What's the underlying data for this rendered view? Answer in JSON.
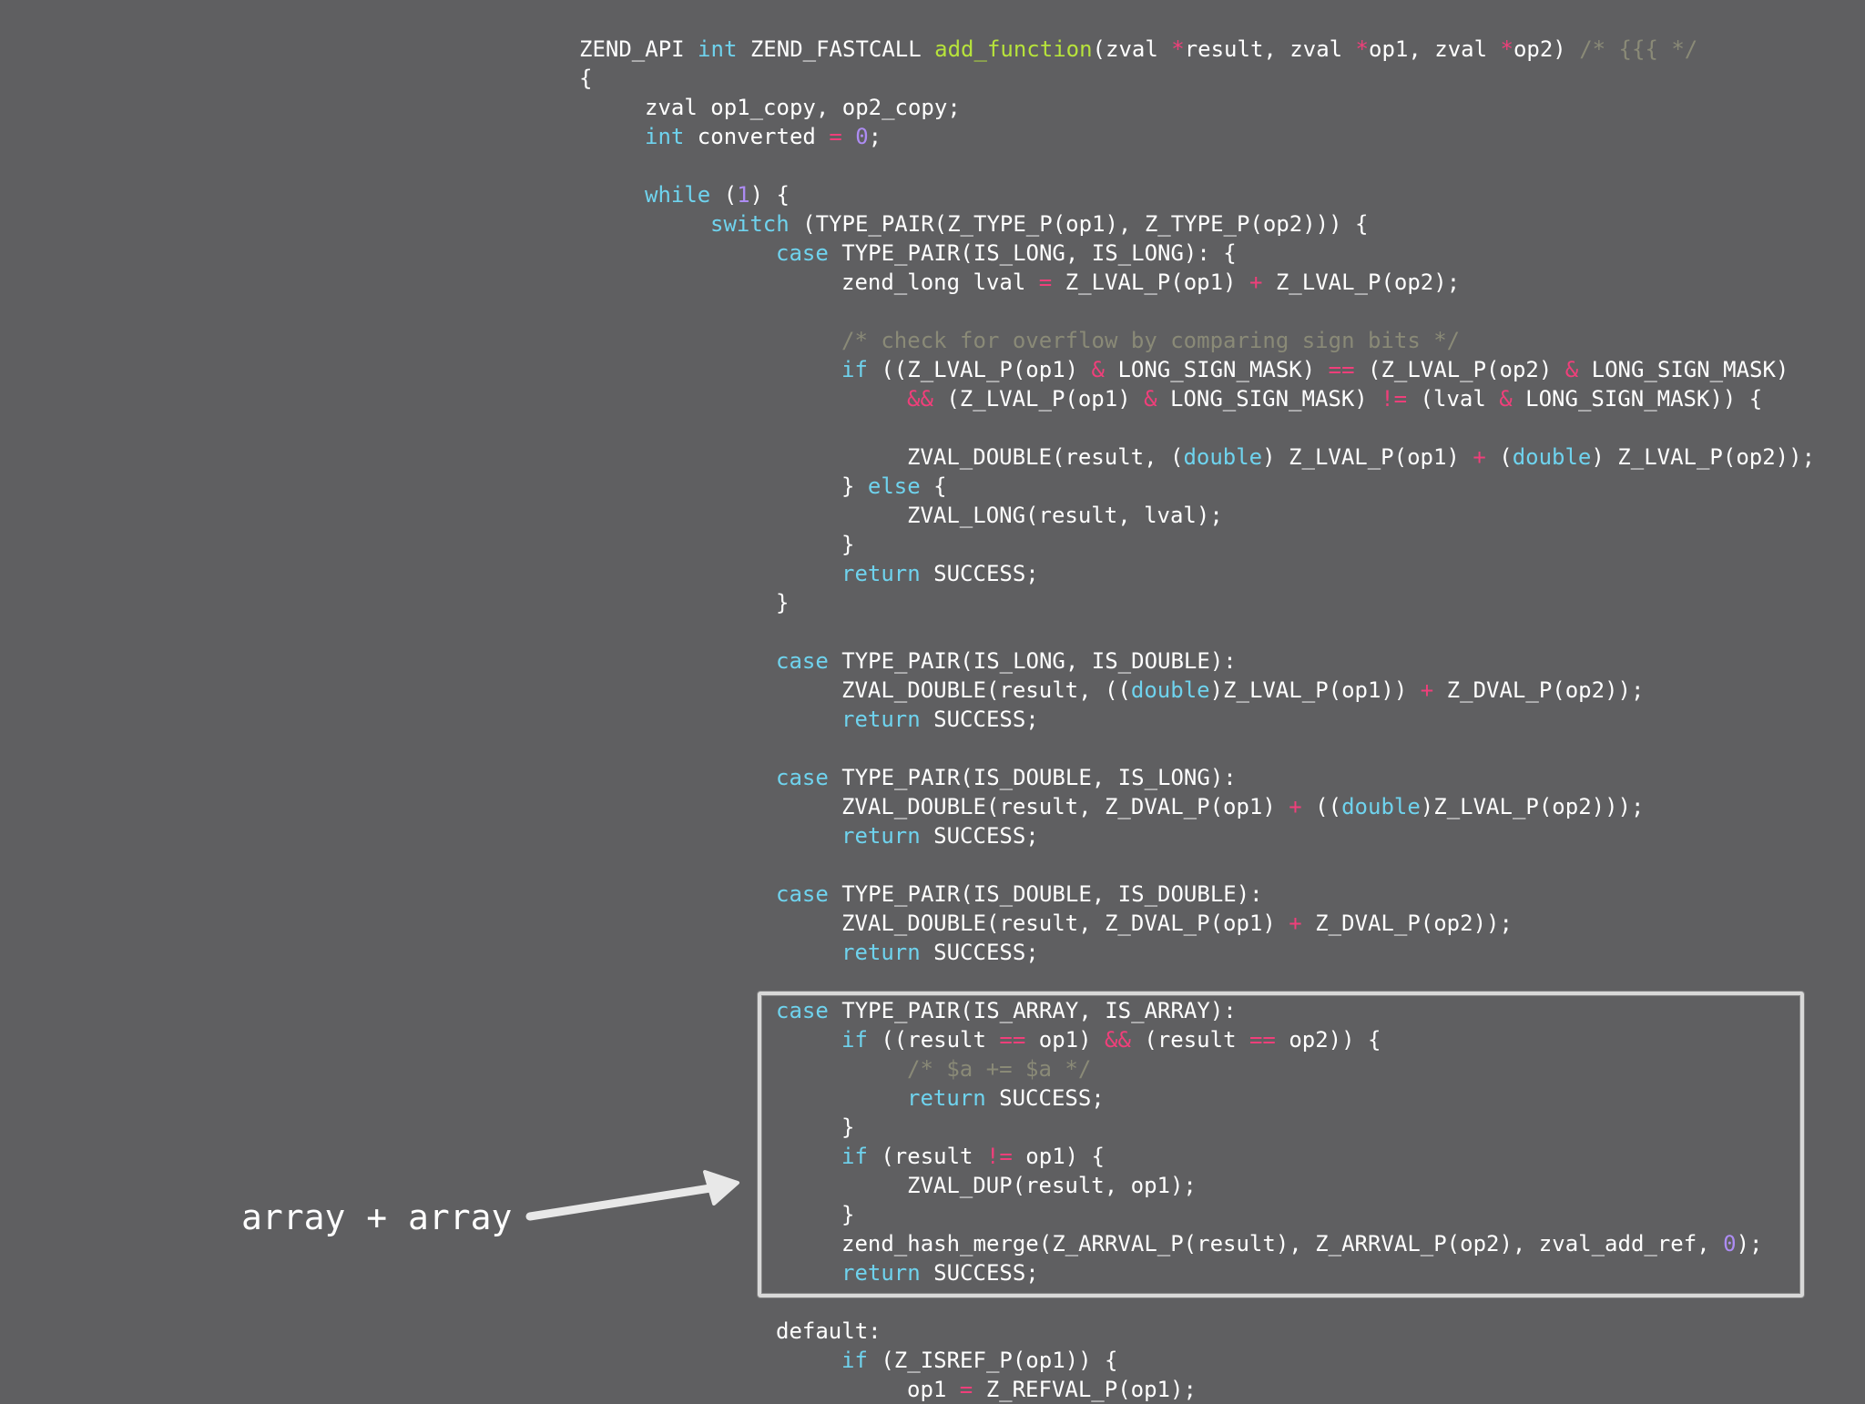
{
  "colors": {
    "background": "#5f5f61",
    "plain": "#ffffff",
    "keyword": "#6fd3ee",
    "function": "#b7e33b",
    "operator": "#ef3f7a",
    "number": "#ad8cf3",
    "comment": "#8a8a77",
    "highlight_border": "#d8d8d8"
  },
  "annotation": {
    "label": "array + array"
  },
  "code_lines": [
    {
      "indent": 0,
      "tokens": [
        [
          "tx",
          "ZEND_API "
        ],
        [
          "kw",
          "int"
        ],
        [
          "tx",
          " ZEND_FASTCALL "
        ],
        [
          "fn",
          "add_function"
        ],
        [
          "tx",
          "(zval "
        ],
        [
          "op",
          "*"
        ],
        [
          "tx",
          "result, zval "
        ],
        [
          "op",
          "*"
        ],
        [
          "tx",
          "op1, zval "
        ],
        [
          "op",
          "*"
        ],
        [
          "tx",
          "op2) "
        ],
        [
          "cm",
          "/* {{{ */"
        ]
      ]
    },
    {
      "indent": 0,
      "tokens": [
        [
          "tx",
          "{"
        ]
      ]
    },
    {
      "indent": 1,
      "tokens": [
        [
          "tx",
          "zval op1_copy, op2_copy;"
        ]
      ]
    },
    {
      "indent": 1,
      "tokens": [
        [
          "kw",
          "int"
        ],
        [
          "tx",
          " converted "
        ],
        [
          "op",
          "="
        ],
        [
          "tx",
          " "
        ],
        [
          "num",
          "0"
        ],
        [
          "tx",
          ";"
        ]
      ]
    },
    {
      "indent": 0,
      "tokens": []
    },
    {
      "indent": 1,
      "tokens": [
        [
          "kw",
          "while"
        ],
        [
          "tx",
          " ("
        ],
        [
          "num",
          "1"
        ],
        [
          "tx",
          ") {"
        ]
      ]
    },
    {
      "indent": 2,
      "tokens": [
        [
          "kw",
          "switch"
        ],
        [
          "tx",
          " (TYPE_PAIR(Z_TYPE_P(op1), Z_TYPE_P(op2))) {"
        ]
      ]
    },
    {
      "indent": 3,
      "tokens": [
        [
          "kw",
          "case"
        ],
        [
          "tx",
          " TYPE_PAIR(IS_LONG, IS_LONG): {"
        ]
      ]
    },
    {
      "indent": 4,
      "tokens": [
        [
          "tx",
          "zend_long lval "
        ],
        [
          "op",
          "="
        ],
        [
          "tx",
          " Z_LVAL_P(op1) "
        ],
        [
          "op",
          "+"
        ],
        [
          "tx",
          " Z_LVAL_P(op2);"
        ]
      ]
    },
    {
      "indent": 0,
      "tokens": []
    },
    {
      "indent": 4,
      "tokens": [
        [
          "cm",
          "/* check for overflow by comparing sign bits */"
        ]
      ]
    },
    {
      "indent": 4,
      "tokens": [
        [
          "kw",
          "if"
        ],
        [
          "tx",
          " ((Z_LVAL_P(op1) "
        ],
        [
          "op",
          "&"
        ],
        [
          "tx",
          " LONG_SIGN_MASK) "
        ],
        [
          "op",
          "=="
        ],
        [
          "tx",
          " (Z_LVAL_P(op2) "
        ],
        [
          "op",
          "&"
        ],
        [
          "tx",
          " LONG_SIGN_MASK)"
        ]
      ]
    },
    {
      "indent": 5,
      "tokens": [
        [
          "op",
          "&&"
        ],
        [
          "tx",
          " (Z_LVAL_P(op1) "
        ],
        [
          "op",
          "&"
        ],
        [
          "tx",
          " LONG_SIGN_MASK) "
        ],
        [
          "op",
          "!="
        ],
        [
          "tx",
          " (lval "
        ],
        [
          "op",
          "&"
        ],
        [
          "tx",
          " LONG_SIGN_MASK)) {"
        ]
      ]
    },
    {
      "indent": 0,
      "tokens": []
    },
    {
      "indent": 5,
      "tokens": [
        [
          "tx",
          "ZVAL_DOUBLE(result, ("
        ],
        [
          "kw",
          "double"
        ],
        [
          "tx",
          ") Z_LVAL_P(op1) "
        ],
        [
          "op",
          "+"
        ],
        [
          "tx",
          " ("
        ],
        [
          "kw",
          "double"
        ],
        [
          "tx",
          ") Z_LVAL_P(op2));"
        ]
      ]
    },
    {
      "indent": 4,
      "tokens": [
        [
          "tx",
          "} "
        ],
        [
          "kw",
          "else"
        ],
        [
          "tx",
          " {"
        ]
      ]
    },
    {
      "indent": 5,
      "tokens": [
        [
          "tx",
          "ZVAL_LONG(result, lval);"
        ]
      ]
    },
    {
      "indent": 4,
      "tokens": [
        [
          "tx",
          "}"
        ]
      ]
    },
    {
      "indent": 4,
      "tokens": [
        [
          "kw",
          "return"
        ],
        [
          "tx",
          " SUCCESS;"
        ]
      ]
    },
    {
      "indent": 3,
      "tokens": [
        [
          "tx",
          "}"
        ]
      ]
    },
    {
      "indent": 0,
      "tokens": []
    },
    {
      "indent": 3,
      "tokens": [
        [
          "kw",
          "case"
        ],
        [
          "tx",
          " TYPE_PAIR(IS_LONG, IS_DOUBLE):"
        ]
      ]
    },
    {
      "indent": 4,
      "tokens": [
        [
          "tx",
          "ZVAL_DOUBLE(result, (("
        ],
        [
          "kw",
          "double"
        ],
        [
          "tx",
          ")Z_LVAL_P(op1)) "
        ],
        [
          "op",
          "+"
        ],
        [
          "tx",
          " Z_DVAL_P(op2));"
        ]
      ]
    },
    {
      "indent": 4,
      "tokens": [
        [
          "kw",
          "return"
        ],
        [
          "tx",
          " SUCCESS;"
        ]
      ]
    },
    {
      "indent": 0,
      "tokens": []
    },
    {
      "indent": 3,
      "tokens": [
        [
          "kw",
          "case"
        ],
        [
          "tx",
          " TYPE_PAIR(IS_DOUBLE, IS_LONG):"
        ]
      ]
    },
    {
      "indent": 4,
      "tokens": [
        [
          "tx",
          "ZVAL_DOUBLE(result, Z_DVAL_P(op1) "
        ],
        [
          "op",
          "+"
        ],
        [
          "tx",
          " (("
        ],
        [
          "kw",
          "double"
        ],
        [
          "tx",
          ")Z_LVAL_P(op2)));"
        ]
      ]
    },
    {
      "indent": 4,
      "tokens": [
        [
          "kw",
          "return"
        ],
        [
          "tx",
          " SUCCESS;"
        ]
      ]
    },
    {
      "indent": 0,
      "tokens": []
    },
    {
      "indent": 3,
      "tokens": [
        [
          "kw",
          "case"
        ],
        [
          "tx",
          " TYPE_PAIR(IS_DOUBLE, IS_DOUBLE):"
        ]
      ]
    },
    {
      "indent": 4,
      "tokens": [
        [
          "tx",
          "ZVAL_DOUBLE(result, Z_DVAL_P(op1) "
        ],
        [
          "op",
          "+"
        ],
        [
          "tx",
          " Z_DVAL_P(op2));"
        ]
      ]
    },
    {
      "indent": 4,
      "tokens": [
        [
          "kw",
          "return"
        ],
        [
          "tx",
          " SUCCESS;"
        ]
      ]
    },
    {
      "indent": 0,
      "tokens": []
    },
    {
      "indent": 3,
      "tokens": [
        [
          "kw",
          "case"
        ],
        [
          "tx",
          " TYPE_PAIR(IS_ARRAY, IS_ARRAY):"
        ]
      ]
    },
    {
      "indent": 4,
      "tokens": [
        [
          "kw",
          "if"
        ],
        [
          "tx",
          " ((result "
        ],
        [
          "op",
          "=="
        ],
        [
          "tx",
          " op1) "
        ],
        [
          "op",
          "&&"
        ],
        [
          "tx",
          " (result "
        ],
        [
          "op",
          "=="
        ],
        [
          "tx",
          " op2)) {"
        ]
      ]
    },
    {
      "indent": 5,
      "tokens": [
        [
          "cm",
          "/* $a += $a */"
        ]
      ]
    },
    {
      "indent": 5,
      "tokens": [
        [
          "kw",
          "return"
        ],
        [
          "tx",
          " SUCCESS;"
        ]
      ]
    },
    {
      "indent": 4,
      "tokens": [
        [
          "tx",
          "}"
        ]
      ]
    },
    {
      "indent": 4,
      "tokens": [
        [
          "kw",
          "if"
        ],
        [
          "tx",
          " (result "
        ],
        [
          "op",
          "!="
        ],
        [
          "tx",
          " op1) {"
        ]
      ]
    },
    {
      "indent": 5,
      "tokens": [
        [
          "tx",
          "ZVAL_DUP(result, op1);"
        ]
      ]
    },
    {
      "indent": 4,
      "tokens": [
        [
          "tx",
          "}"
        ]
      ]
    },
    {
      "indent": 4,
      "tokens": [
        [
          "tx",
          "zend_hash_merge(Z_ARRVAL_P(result), Z_ARRVAL_P(op2), zval_add_ref, "
        ],
        [
          "num",
          "0"
        ],
        [
          "tx",
          ");"
        ]
      ]
    },
    {
      "indent": 4,
      "tokens": [
        [
          "kw",
          "return"
        ],
        [
          "tx",
          " SUCCESS;"
        ]
      ]
    },
    {
      "indent": 0,
      "tokens": []
    },
    {
      "indent": 3,
      "tokens": [
        [
          "tx",
          "default:"
        ]
      ]
    },
    {
      "indent": 4,
      "tokens": [
        [
          "kw",
          "if"
        ],
        [
          "tx",
          " (Z_ISREF_P(op1)) {"
        ]
      ]
    },
    {
      "indent": 5,
      "tokens": [
        [
          "tx",
          "op1 "
        ],
        [
          "op",
          "="
        ],
        [
          "tx",
          " Z_REFVAL_P(op1);"
        ]
      ]
    }
  ]
}
